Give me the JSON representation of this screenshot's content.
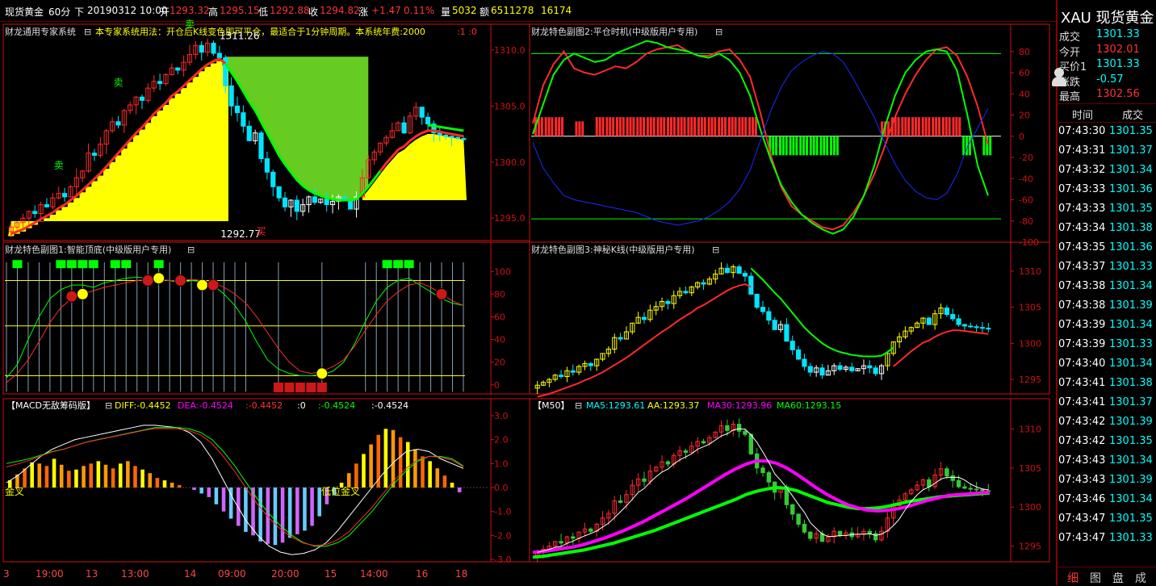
{
  "header": {
    "symbol": "现货黄金",
    "period": "60分",
    "arrow": "下",
    "datetime": "20190312 10:00",
    "open_label": "开",
    "open": "1293.32",
    "high_label": "高",
    "high": "1295.15",
    "low_label": "低",
    "low": "1292.88",
    "close_label": "收",
    "close": "1294.82",
    "change_label": "涨",
    "change": "+1.47",
    "change_pct": "0.11%",
    "volume_label": "量",
    "volume": "5032",
    "amount_label": "额",
    "amount": "6511278",
    "extra": "16174"
  },
  "sidebar": {
    "title": "XAU  现货黄金",
    "quote": [
      {
        "label": "成交",
        "value": "1301.33",
        "color": "#00ffff"
      },
      {
        "label": "今开",
        "value": "1302.01",
        "color": "#ff3333"
      },
      {
        "label": "买价1",
        "value": "1301.33",
        "color": "#00ffff"
      },
      {
        "label": "涨跌",
        "value": "-0.57",
        "color": "#00ffff"
      },
      {
        "label": "最高",
        "value": "1302.56",
        "color": "#ff3333"
      }
    ],
    "tick_header_time": "时间",
    "tick_header_price": "成交",
    "ticks": [
      {
        "t": "07:43:30",
        "p": "1301.35"
      },
      {
        "t": "07:43:31",
        "p": "1301.37"
      },
      {
        "t": "07:43:32",
        "p": "1301.34"
      },
      {
        "t": "07:43:33",
        "p": "1301.36"
      },
      {
        "t": "07:43:33",
        "p": "1301.35"
      },
      {
        "t": "07:43:34",
        "p": "1301.38"
      },
      {
        "t": "07:43:35",
        "p": "1301.36"
      },
      {
        "t": "07:43:37",
        "p": "1301.33"
      },
      {
        "t": "07:43:38",
        "p": "1301.34"
      },
      {
        "t": "07:43:38",
        "p": "1301.39"
      },
      {
        "t": "07:43:39",
        "p": "1301.34"
      },
      {
        "t": "07:43:39",
        "p": "1301.33"
      },
      {
        "t": "07:43:40",
        "p": "1301.34"
      },
      {
        "t": "07:43:41",
        "p": "1301.38"
      },
      {
        "t": "07:43:41",
        "p": "1301.37"
      },
      {
        "t": "07:43:42",
        "p": "1301.39"
      },
      {
        "t": "07:43:42",
        "p": "1301.35"
      },
      {
        "t": "07:43:43",
        "p": "1301.34"
      },
      {
        "t": "07:43:43",
        "p": "1301.39"
      },
      {
        "t": "07:43:46",
        "p": "1301.34"
      },
      {
        "t": "07:43:47",
        "p": "1301.35"
      },
      {
        "t": "07:43:47",
        "p": "1301.33"
      }
    ],
    "tabs": [
      "细",
      "图",
      "盘",
      "成"
    ]
  },
  "xaxis_labels": [
    "3",
    "19:00",
    "13",
    "13:00",
    "14",
    "09:00",
    "20:00",
    "15",
    "14:00",
    "16",
    "18"
  ],
  "colors": {
    "up": "#ff2a2a",
    "down": "#00e5ff",
    "axis_red": "#d01010",
    "yellow": "#ffff00",
    "green": "#00ff00",
    "lime_fill": "#66cc22",
    "magenta": "#ff00ff",
    "blue": "#1a2aff",
    "white": "#ffffff"
  },
  "chart_data": [
    {
      "name": "main",
      "type": "candlestick",
      "title": "财龙通用专家系统",
      "note": "本专家系统用法：开仓后K线变色即可平仓，最适合于1分钟周期。本系统年费:2000",
      "note_tail": ":1  :0",
      "ylim": [
        1293,
        1311
      ],
      "ticks": [
        "1310.0",
        "1305.0",
        "1300.0",
        "1295.0"
      ],
      "tick_values": [
        1310,
        1305,
        1300,
        1295
      ],
      "annotations": {
        "high_label": "1311.26",
        "low_label": "1292.77",
        "sell": "卖",
        "buy": "买"
      },
      "close": [
        1294.2,
        1294.6,
        1295.0,
        1295.6,
        1295.4,
        1296.2,
        1296.0,
        1296.8,
        1297.2,
        1296.9,
        1297.8,
        1298.6,
        1299.2,
        1300.8,
        1300.6,
        1301.6,
        1302.8,
        1303.6,
        1303.3,
        1304.6,
        1305.1,
        1305.8,
        1305.5,
        1306.6,
        1307.2,
        1307.0,
        1307.8,
        1308.4,
        1308.2,
        1308.9,
        1309.6,
        1310.4,
        1309.8,
        1310.6,
        1309.7,
        1309.3,
        1306.8,
        1305.0,
        1304.4,
        1303.2,
        1301.9,
        1302.6,
        1300.3,
        1299.1,
        1297.8,
        1296.8,
        1296.0,
        1296.6,
        1295.6,
        1296.2,
        1296.9,
        1296.4,
        1296.7,
        1296.2,
        1296.5,
        1296.9,
        1296.6,
        1295.8,
        1296.9,
        1298.6,
        1300.2,
        1300.9,
        1301.7,
        1302.2,
        1302.8,
        1303.5,
        1302.6,
        1304.1,
        1304.9,
        1304.0,
        1303.4,
        1302.6,
        1302.4,
        1302.3,
        1302.2,
        1302.1,
        1302.0
      ],
      "expert_line": [
        1293.6,
        1293.8,
        1294.0,
        1294.3,
        1294.6,
        1294.9,
        1295.2,
        1295.5,
        1295.9,
        1296.2,
        1296.6,
        1297.0,
        1297.5,
        1298.0,
        1298.5,
        1299.0,
        1299.6,
        1300.2,
        1300.8,
        1301.4,
        1302.0,
        1302.6,
        1303.1,
        1303.7,
        1304.3,
        1304.8,
        1305.3,
        1305.9,
        1306.3,
        1306.8,
        1307.3,
        1307.8,
        1308.3,
        1308.7,
        1309.0,
        1309.2,
        1308.8,
        1308.0,
        1307.2,
        1306.3,
        1305.4,
        1304.6,
        1303.6,
        1302.6,
        1301.6,
        1300.6,
        1299.8,
        1299.1,
        1298.4,
        1297.9,
        1297.5,
        1297.2,
        1297.0,
        1296.8,
        1296.7,
        1296.6,
        1296.6,
        1296.6,
        1296.7,
        1297.2,
        1297.8,
        1298.5,
        1299.2,
        1299.9,
        1300.5,
        1301.1,
        1301.4,
        1301.9,
        1302.3,
        1302.6,
        1302.8,
        1302.8,
        1302.7,
        1302.6,
        1302.5,
        1302.4,
        1302.3
      ]
    },
    {
      "name": "sub2",
      "type": "line",
      "title": "财龙特色副图2:平仓时机(中级版用户专用)",
      "ylim": [
        -100,
        92
      ],
      "ticks": [
        "80",
        "60",
        "40",
        "20",
        "0",
        "-20",
        "-40",
        "-60",
        "-80",
        "-100"
      ],
      "tick_values": [
        80,
        60,
        40,
        20,
        0,
        -20,
        -40,
        -60,
        -80,
        -100
      ],
      "levels": [
        78,
        -78
      ],
      "series": [
        {
          "color": "red",
          "values": [
            12,
            48,
            68,
            80,
            64,
            60,
            58,
            62,
            66,
            64,
            70,
            78,
            82,
            84,
            86,
            80,
            76,
            76,
            80,
            82,
            72,
            56,
            22,
            -18,
            -48,
            -66,
            -74,
            -80,
            -86,
            -88,
            -84,
            -72,
            -56,
            -36,
            -10,
            18,
            40,
            58,
            72,
            82,
            84,
            76,
            56,
            28,
            -8
          ]
        },
        {
          "color": "green",
          "values": [
            2,
            30,
            58,
            72,
            78,
            74,
            70,
            72,
            78,
            82,
            86,
            90,
            88,
            84,
            82,
            80,
            76,
            74,
            78,
            72,
            60,
            38,
            6,
            -22,
            -46,
            -62,
            -74,
            -82,
            -88,
            -92,
            -88,
            -76,
            -56,
            -28,
            8,
            38,
            60,
            72,
            80,
            82,
            80,
            62,
            20,
            -28,
            -56
          ]
        },
        {
          "color": "blue",
          "values": [
            -6,
            -30,
            -44,
            -56,
            -60,
            -62,
            -64,
            -66,
            -68,
            -70,
            -72,
            -76,
            -80,
            -82,
            -84,
            -82,
            -80,
            -76,
            -70,
            -62,
            -50,
            -32,
            -4,
            24,
            46,
            62,
            70,
            76,
            80,
            78,
            70,
            54,
            36,
            18,
            -6,
            -26,
            -42,
            -52,
            -58,
            -60,
            -54,
            -36,
            -10,
            8,
            26
          ]
        }
      ],
      "bars": [
        18,
        18,
        18,
        0,
        14,
        0,
        18,
        18,
        18,
        18,
        18,
        18,
        18,
        18,
        18,
        18,
        18,
        18,
        18,
        18,
        18,
        18,
        0,
        -18,
        -18,
        -18,
        -18,
        -18,
        -18,
        -18,
        0,
        0,
        0,
        0,
        14,
        18,
        18,
        18,
        18,
        18,
        18,
        18,
        -18,
        0,
        -18
      ]
    },
    {
      "name": "sub1",
      "type": "line",
      "title": "财龙特色副图1:智能顶底(中级版用户专用)",
      "ylim": [
        -8,
        113
      ],
      "ticks": [
        "100",
        "80",
        "60",
        "40",
        "20",
        "0"
      ],
      "tick_values": [
        100,
        80,
        60,
        40,
        20,
        0
      ],
      "levels": [
        92,
        52,
        8
      ],
      "series": [
        {
          "color": "green",
          "values": [
            6,
            18,
            40,
            60,
            76,
            84,
            88,
            88,
            86,
            90,
            92,
            94,
            95,
            94,
            93,
            92,
            90,
            92,
            91,
            88,
            80,
            70,
            56,
            38,
            22,
            14,
            10,
            8,
            8,
            9,
            12,
            20,
            36,
            56,
            74,
            86,
            92,
            94,
            88,
            82,
            76,
            72,
            70
          ]
        },
        {
          "color": "red",
          "values": [
            2,
            10,
            22,
            38,
            55,
            68,
            76,
            80,
            83,
            86,
            88,
            90,
            92,
            93,
            93,
            92,
            92,
            93,
            92,
            90,
            86,
            80,
            72,
            60,
            46,
            32,
            20,
            12,
            10,
            12,
            16,
            22,
            34,
            48,
            62,
            74,
            82,
            88,
            90,
            86,
            80,
            74,
            70
          ]
        }
      ],
      "top_bars": [
        0,
        1,
        0,
        0,
        0,
        1,
        1,
        1,
        1,
        0,
        1,
        1,
        0,
        0,
        1,
        0,
        0,
        0,
        0,
        0,
        0,
        0,
        0,
        0,
        0,
        0,
        0,
        0,
        0,
        0,
        0,
        0,
        0,
        0,
        0,
        1,
        1,
        1,
        0,
        0,
        0,
        0,
        0
      ],
      "bottom_bars": [
        0,
        0,
        0,
        0,
        0,
        0,
        0,
        0,
        0,
        0,
        0,
        0,
        0,
        0,
        0,
        0,
        0,
        0,
        0,
        0,
        0,
        0,
        0,
        0,
        0,
        1,
        1,
        1,
        1,
        1,
        0,
        0,
        0,
        0,
        0,
        0,
        0,
        0,
        0,
        0,
        0,
        0,
        0
      ]
    },
    {
      "name": "sub3",
      "type": "candlestick",
      "title": "财龙特色副图3:神秘K线(中级版用户专用)",
      "ylim": [
        1293,
        1312
      ],
      "ticks": [
        "1310",
        "1305",
        "1300",
        "1295"
      ],
      "tick_values": [
        1310,
        1305,
        1300,
        1295
      ]
    },
    {
      "name": "macd",
      "type": "bar",
      "title": "【MACD无敌筹码版】",
      "legend": [
        {
          "text": "DIFF:-0.4452",
          "color": "#ffff00"
        },
        {
          "text": "DEA:-0.4524",
          "color": "#ff00ff"
        },
        {
          "text": ":-0.4452",
          "color": "#ff3333"
        },
        {
          "text": ":0",
          "color": "#ffffff"
        },
        {
          "text": ":-0.4524",
          "color": "#00ff00"
        },
        {
          "text": ":-0.4524",
          "color": "#ffffff"
        }
      ],
      "ylim": [
        -3.1,
        3.1
      ],
      "ticks": [
        "3.0",
        "2.0",
        "1.0",
        "0.0",
        "-1.0",
        "-2.0",
        "-3.0"
      ],
      "tick_values": [
        3,
        2,
        1,
        0,
        -1,
        -2,
        -3
      ],
      "annotations": [
        "金叉",
        "低位金叉"
      ],
      "hist": [
        0.3,
        0.55,
        0.8,
        1.05,
        1.0,
        0.9,
        1.2,
        0.95,
        0.7,
        0.75,
        0.9,
        1.0,
        1.1,
        0.95,
        0.8,
        1.0,
        1.1,
        0.9,
        0.75,
        0.6,
        0.4,
        0.3,
        0.2,
        0.1,
        0.0,
        -0.1,
        -0.25,
        -0.4,
        -0.7,
        -1.0,
        -1.3,
        -1.6,
        -1.85,
        -2.0,
        -2.25,
        -2.35,
        -2.4,
        -2.3,
        -2.1,
        -1.95,
        -1.8,
        -1.6,
        -1.2,
        -0.7,
        -0.3,
        0.2,
        0.6,
        1.0,
        1.4,
        1.8,
        2.2,
        2.45,
        2.4,
        2.1,
        1.9,
        1.6,
        1.3,
        1.1,
        0.8,
        0.5,
        0.2,
        -0.2
      ],
      "diff": [
        0.2,
        0.5,
        0.9,
        1.3,
        1.6,
        1.8,
        2.0,
        2.1,
        2.2,
        2.3,
        2.4,
        2.5,
        2.6,
        2.6,
        2.55,
        2.5,
        2.3,
        1.9,
        1.2,
        0.3,
        -0.6,
        -1.4,
        -2.0,
        -2.45,
        -2.7,
        -2.8,
        -2.75,
        -2.6,
        -2.3,
        -1.8,
        -1.2,
        -0.6,
        0.0,
        0.6,
        1.1,
        1.5,
        1.6,
        1.5,
        1.2,
        1.0,
        0.8
      ],
      "dea": [
        1.0,
        1.1,
        1.2,
        1.35,
        1.5,
        1.6,
        1.75,
        1.9,
        2.0,
        2.1,
        2.2,
        2.3,
        2.4,
        2.5,
        2.5,
        2.5,
        2.45,
        2.3,
        2.0,
        1.5,
        0.9,
        0.2,
        -0.5,
        -1.1,
        -1.6,
        -2.0,
        -2.3,
        -2.45,
        -2.45,
        -2.3,
        -2.0,
        -1.5,
        -1.0,
        -0.4,
        0.2,
        0.7,
        1.1,
        1.3,
        1.3,
        1.2,
        0.9
      ]
    },
    {
      "name": "m50",
      "type": "candlestick",
      "title": "【M50】",
      "legend": [
        {
          "text": "MA5:1293.61",
          "color": "#00ffff"
        },
        {
          "text": "AA:1293.37",
          "color": "#ffff00"
        },
        {
          "text": "MA30:1293.96",
          "color": "#ff00ff"
        },
        {
          "text": "MA60:1293.15",
          "color": "#00ff00"
        }
      ],
      "ylim": [
        1293,
        1312
      ],
      "ticks": [
        "1310",
        "1305",
        "1300",
        "1295"
      ],
      "tick_values": [
        1310,
        1305,
        1300,
        1295
      ],
      "ma30": [
        1294.2,
        1294.3,
        1294.5,
        1294.7,
        1294.9,
        1295.2,
        1295.6,
        1296.0,
        1296.5,
        1297.0,
        1297.6,
        1298.2,
        1298.9,
        1299.6,
        1300.3,
        1301.0,
        1301.8,
        1302.6,
        1303.4,
        1304.2,
        1304.9,
        1305.5,
        1305.9,
        1305.9,
        1305.6,
        1305.0,
        1304.2,
        1303.3,
        1302.4,
        1301.6,
        1300.9,
        1300.3,
        1299.9,
        1299.6,
        1299.5,
        1299.6,
        1299.8,
        1300.1,
        1300.5,
        1300.9,
        1301.2,
        1301.5,
        1301.6,
        1301.7,
        1301.8,
        1301.9
      ],
      "ma60": [
        1293.6,
        1293.7,
        1293.9,
        1294.1,
        1294.3,
        1294.5,
        1294.8,
        1295.1,
        1295.4,
        1295.8,
        1296.2,
        1296.6,
        1297.0,
        1297.5,
        1298.0,
        1298.5,
        1299.0,
        1299.5,
        1300.0,
        1300.5,
        1301.0,
        1301.6,
        1302.0,
        1302.3,
        1302.5,
        1302.4,
        1302.1,
        1301.6,
        1301.1,
        1300.6,
        1300.3,
        1300.0,
        1299.8,
        1299.8,
        1299.9,
        1300.1,
        1300.4,
        1300.7,
        1300.9,
        1301.1,
        1301.3,
        1301.4,
        1301.5,
        1301.6,
        1301.7,
        1301.8
      ]
    }
  ]
}
